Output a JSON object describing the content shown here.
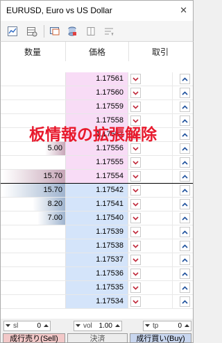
{
  "window": {
    "title": "EURUSD, Euro vs US Dollar",
    "close_icon": "close-icon"
  },
  "toolbar": {
    "icons": [
      "chart-icon",
      "calendar-grid-icon",
      "display-settings-icon",
      "depth-disk-icon",
      "columns-icon",
      "sort-icon"
    ]
  },
  "header": {
    "qty": "数量",
    "price": "価格",
    "trade": "取引"
  },
  "overlay": {
    "text": "板情報の拡張解除"
  },
  "ask_rows": [
    {
      "qty": "",
      "price": "1.17561"
    },
    {
      "qty": "",
      "price": "1.17560"
    },
    {
      "qty": "",
      "price": "1.17559"
    },
    {
      "qty": "",
      "price": "1.17558"
    },
    {
      "qty": "",
      "price": "1.17557"
    },
    {
      "qty": "5.00",
      "price": "1.17556"
    },
    {
      "qty": "",
      "price": "1.17555"
    },
    {
      "qty": "15.70",
      "price": "1.17554"
    }
  ],
  "bid_rows": [
    {
      "qty": "15.70",
      "price": "1.17542"
    },
    {
      "qty": "8.20",
      "price": "1.17541"
    },
    {
      "qty": "7.00",
      "price": "1.17540"
    },
    {
      "qty": "",
      "price": "1.17539"
    },
    {
      "qty": "",
      "price": "1.17538"
    },
    {
      "qty": "",
      "price": "1.17537"
    },
    {
      "qty": "",
      "price": "1.17536"
    },
    {
      "qty": "",
      "price": "1.17535"
    },
    {
      "qty": "",
      "price": "1.17534"
    }
  ],
  "controls": {
    "sl": {
      "label": "sl",
      "value": "0"
    },
    "vol": {
      "label": "vol",
      "value": "1.00"
    },
    "tp": {
      "label": "tp",
      "value": "0"
    },
    "sell_label": "成行売り(Sell)",
    "close_label": "決済",
    "buy_label": "成行買い(Buy)"
  },
  "colors": {
    "ask_price_bg": "#f8dcf6",
    "bid_price_bg": "#d4e4fa",
    "ask_qty_bar": "#c7a6b8",
    "bid_qty_bar": "#9fb4cf",
    "overlay_text": "#e8192c",
    "sell_button": "#f2c8c8",
    "buy_button": "#c8d6ef"
  }
}
